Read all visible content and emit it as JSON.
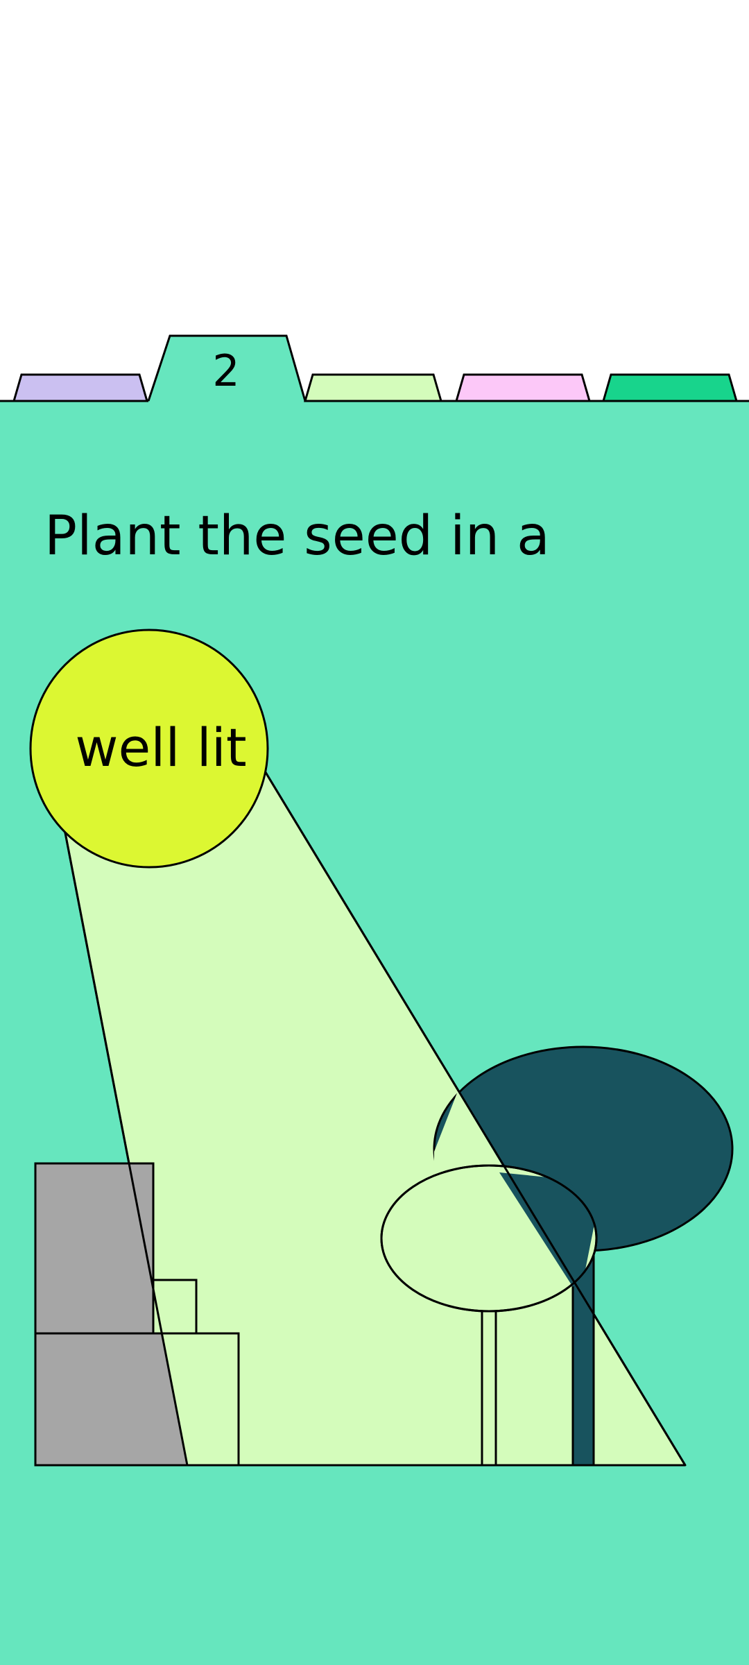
{
  "tabs": {
    "items": [
      {
        "label": "",
        "color": "#cbc0f1",
        "active": false
      },
      {
        "label": "2",
        "color": "#66e6be",
        "active": true
      },
      {
        "label": "",
        "color": "#d4fcbb",
        "active": false
      },
      {
        "label": "",
        "color": "#fcc8f8",
        "active": false
      },
      {
        "label": "",
        "color": "#18d48c",
        "active": false
      }
    ]
  },
  "content": {
    "heading": "Plant the seed in a",
    "sun_label": "well lit"
  },
  "colors": {
    "background": "#66e6be",
    "light_beam": "#d4fcbb",
    "sun": "#dcf732",
    "building": "#a6a6a6",
    "tree_dark": "#18535e",
    "outline": "#000000"
  }
}
